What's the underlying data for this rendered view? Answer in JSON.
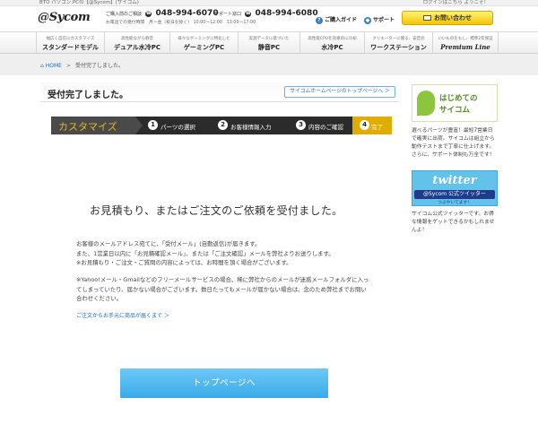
{
  "topstrip": {
    "left": "BTO パソコン.PCの【@Sycom】(サイコム)",
    "right": "ログインはこちら ようこそ！"
  },
  "header": {
    "logo": "@Sycom",
    "order_phone": {
      "label": "ご購入前のご相談",
      "number": "048-994-6070",
      "hours": "お電話での受付時間　月〜金（祝日を除く） 10:00〜12:00　13:00〜17:00"
    },
    "support_phone": {
      "label": "サポート窓口",
      "number": "048-994-6080"
    },
    "guide_label": "ご購入ガイド",
    "support_label": "サポート",
    "contact_label": "お問い合わせ"
  },
  "nav": [
    {
      "sub": "幅広く自在にカスタマイズ",
      "main": "スタンダードモデル"
    },
    {
      "sub": "高性能ながら静音",
      "main": "デュアル水冷PC"
    },
    {
      "sub": "様々なゲーミングに特化した",
      "main": "ゲーミングPC"
    },
    {
      "sub": "実測データに基づいた",
      "main": "静音PC"
    },
    {
      "sub": "高性能CPUを効果的に冷却",
      "main": "水冷PC"
    },
    {
      "sub": "クリエーターに贈る、安定の",
      "main": "ワークステーション"
    },
    {
      "sub": "いいものをもし、標準2年保証",
      "main": "Premium Line"
    }
  ],
  "breadcrumb": {
    "home": "HOME",
    "separator": ">",
    "current": "受付完了しました。"
  },
  "main": {
    "title": "受付完了しました。",
    "toppage_link": "サイコムホームページのトップページへ ＞",
    "steps": {
      "first": "カスタマイズ",
      "items": [
        {
          "n": "1",
          "label": "パーツの選択"
        },
        {
          "n": "2",
          "label": "お客様情報入力"
        },
        {
          "n": "3",
          "label": "内容のご確認"
        }
      ],
      "active": {
        "n": "4",
        "label": "完了"
      }
    },
    "message": "お見積もり、またはご注文のご依頼を受付ました。",
    "para1": "お客様のメールアドレス宛てに、「受付メール」(自動返信)が届きます。\nまた、1営業日以内に「お見積確認メール」、または「ご注文確認」メールを弊社よりお送りします。\n※お見積もり・ご注文・ご質問の内容によっては、お時間を頂く場合がございます。",
    "para2": "※Yahoo!メール・Gmailなどのフリーメールサービスの場合、稀に弊社からのメールが迷惑メールフォルダに入ってしまっていたり、届かない場合がございます。数日たってもメールが届かない場合は、念のため弊社までお問い合わせください。",
    "link": "ご注文からお手元に商品が届くまで ＞",
    "top_button": "トップページへ"
  },
  "sidebar": {
    "banner1": {
      "line1": "はじめての",
      "line2": "サイコム"
    },
    "text1": "選べるパーツが豊富！最短7営業日で確実に出荷。サイコムは組立から動作テストまで丁寧に仕上げます。さらに、サポート体制も万全です！",
    "banner2": {
      "title": "twitter",
      "sub": "@Sycom 公式ツイッター",
      "sub2": "つぶやいてます！"
    },
    "text2": "サイコム公式ツイッターです。お得な情報をゲットできるかもしれませんよ！"
  }
}
